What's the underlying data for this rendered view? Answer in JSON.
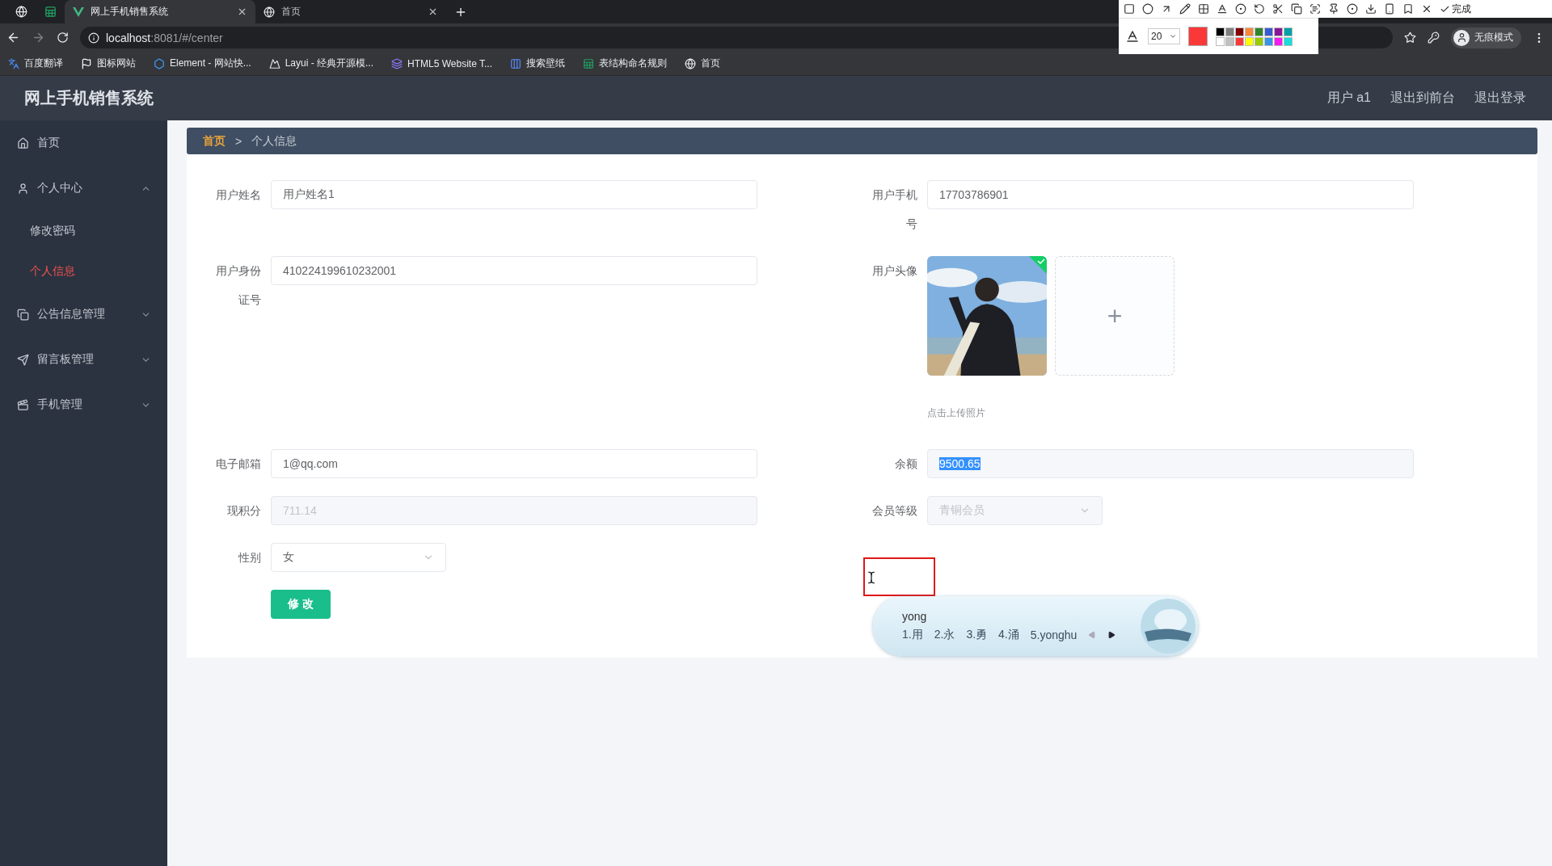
{
  "browser": {
    "tabs": [
      {
        "kind": "pinned-globe",
        "selected": false
      },
      {
        "kind": "pinned-sheet",
        "selected": false
      },
      {
        "kind": "page",
        "title": "网上手机销售系统",
        "selected": true
      },
      {
        "kind": "page",
        "title": "首页",
        "selected": false
      }
    ],
    "address": {
      "host": "localhost",
      "path": ":8081/#/center"
    },
    "bookmarks": [
      {
        "label": "百度翻译"
      },
      {
        "label": "图标网站"
      },
      {
        "label": "Element - 网站快..."
      },
      {
        "label": "Layui - 经典开源模..."
      },
      {
        "label": "HTML5 Website T..."
      },
      {
        "label": "搜索壁纸"
      },
      {
        "label": "表结构命名规则"
      },
      {
        "label": "首页"
      }
    ],
    "profile": "无痕模式"
  },
  "annotation_toolbar": {
    "done": "完成",
    "font_size": "20",
    "palette": [
      {
        "color": "#000000"
      },
      {
        "color": "#808080"
      },
      {
        "color": "#800000"
      },
      {
        "color": "#f7883a"
      },
      {
        "color": "#308430"
      },
      {
        "color": "#385ad3"
      },
      {
        "color": "#881798"
      },
      {
        "color": "#009faa"
      },
      {
        "color": "#ffffff"
      },
      {
        "color": "#c0c0c0"
      },
      {
        "color": "#fb3838"
      },
      {
        "color": "#ffff00"
      },
      {
        "color": "#99cc00"
      },
      {
        "color": "#3894e4"
      },
      {
        "color": "#f31bef"
      },
      {
        "color": "#16dcdc"
      }
    ]
  },
  "app": {
    "title": "网上手机销售系统",
    "header_links": [
      "用户 a1",
      "退出到前台",
      "退出登录"
    ],
    "sidebar": [
      {
        "label": "首页",
        "selected": false
      },
      {
        "label": "个人中心",
        "selected": false,
        "expanded": true,
        "children": [
          {
            "label": "修改密码",
            "selected": false
          },
          {
            "label": "个人信息",
            "selected": true
          }
        ]
      },
      {
        "label": "公告信息管理",
        "selected": false,
        "expanded": false
      },
      {
        "label": "留言板管理",
        "selected": false,
        "expanded": false
      },
      {
        "label": "手机管理",
        "selected": false,
        "expanded": false
      }
    ],
    "breadcrumb": {
      "items": [
        "首页",
        "个人信息"
      ],
      "separator": ">"
    },
    "form": {
      "rows": [
        {
          "left": {
            "kind": "input",
            "label": "用户姓名",
            "value": "用户姓名1",
            "disabled": false,
            "highlighted": false
          },
          "right": {
            "kind": "input",
            "label": "用户手机号",
            "value": "17703786901",
            "disabled": false,
            "highlighted": false
          }
        },
        {
          "left": {
            "kind": "input",
            "label": "用户身份证号",
            "value": "410224199610232001",
            "disabled": false,
            "highlighted": false
          },
          "right": {
            "kind": "upload",
            "label": "用户头像",
            "uploaded": true,
            "hint": "点击上传照片",
            "add": "+"
          }
        },
        {
          "left": {
            "kind": "input",
            "label": "电子邮箱",
            "value": "1@qq.com",
            "disabled": false,
            "highlighted": false
          },
          "right": {
            "kind": "input",
            "label": "余额",
            "value": "9500.65",
            "disabled": true,
            "highlighted": true
          }
        },
        {
          "left": {
            "kind": "input",
            "label": "现积分",
            "value": "711.14",
            "disabled": true,
            "highlighted": false
          },
          "right": {
            "kind": "select",
            "label": "会员等级",
            "value": "青铜会员",
            "disabled": true
          }
        },
        {
          "left": {
            "kind": "select",
            "label": "性别",
            "value": "女",
            "disabled": false
          }
        }
      ],
      "submit": "修 改"
    }
  },
  "ime": {
    "input": "yong",
    "candidates": [
      "1.用",
      "2.永",
      "3.勇",
      "4.涌",
      "5.yonghu"
    ]
  }
}
